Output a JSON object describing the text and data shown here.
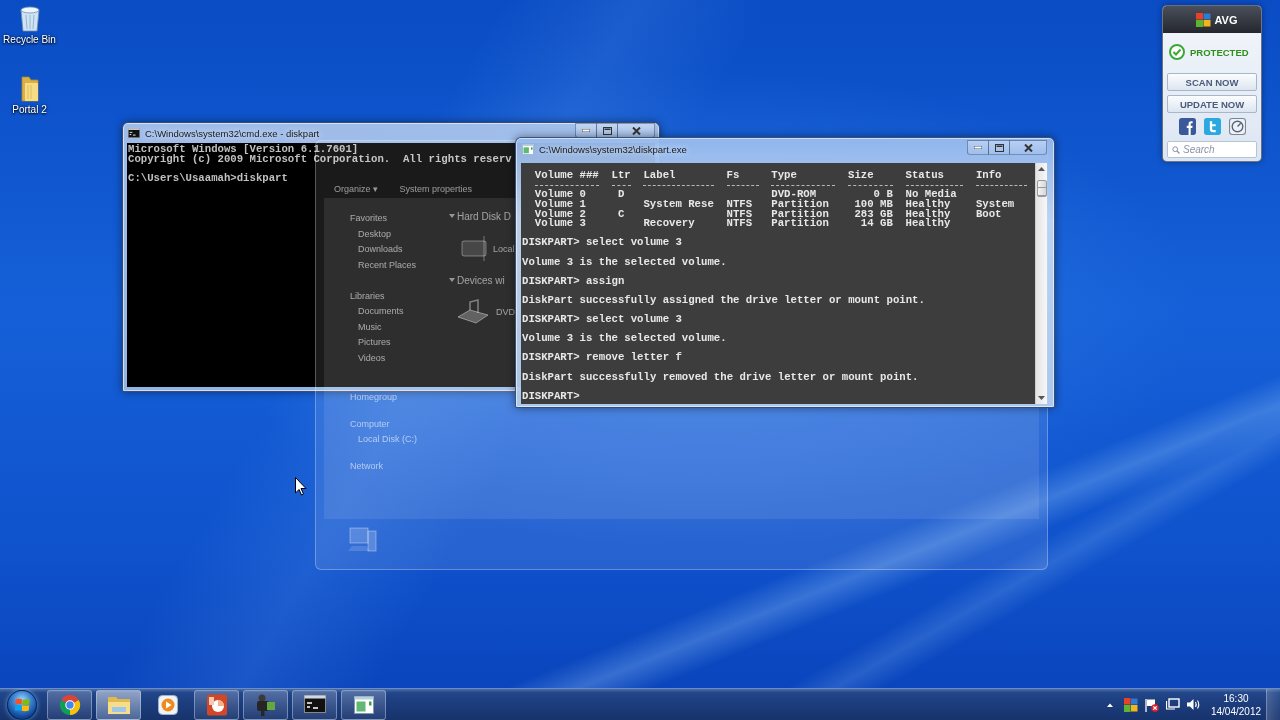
{
  "desktop_icons": [
    {
      "kind": "recycle_bin",
      "label": "Recycle Bin"
    },
    {
      "kind": "folder",
      "label": "Portal 2"
    }
  ],
  "cmd_window": {
    "title": "C:\\Windows\\system32\\cmd.exe - diskpart",
    "blocks": [
      [
        "Microsoft Windows [Version 6.1.7601]",
        "Copyright (c) 2009 Microsoft Corporation.  All rights reserv"
      ],
      [
        "C:\\Users\\Usaamah>diskpart"
      ]
    ]
  },
  "explorer_ghost": {
    "toolbar": [
      "Organize ▾",
      "System properties"
    ],
    "sidebar": [
      {
        "label": "Favorites",
        "children": [
          {
            "label": "Desktop"
          },
          {
            "label": "Downloads"
          },
          {
            "label": "Recent Places"
          }
        ]
      },
      {
        "label": "Libraries",
        "children": [
          {
            "label": "Documents"
          },
          {
            "label": "Music"
          },
          {
            "label": "Pictures"
          },
          {
            "label": "Videos"
          }
        ]
      },
      {
        "label": "Homegroup"
      },
      {
        "label": "Computer",
        "children": [
          {
            "label": "Local Disk (C:)"
          }
        ]
      },
      {
        "label": "Network"
      }
    ],
    "groups": [
      {
        "title": "Hard Disk D",
        "items": [
          {
            "kind": "drive",
            "label": "Local"
          }
        ]
      },
      {
        "title": "Devices wi",
        "items": [
          {
            "kind": "dvd",
            "label": "DVD"
          }
        ]
      }
    ]
  },
  "diskpart_window": {
    "title": "C:\\Windows\\system32\\diskpart.exe",
    "table": {
      "columns": [
        "Volume ###",
        "Ltr",
        "Label",
        "Fs",
        "Type",
        "Size",
        "Status",
        "Info"
      ],
      "rows": [
        [
          "Volume 0",
          "D",
          null,
          null,
          "DVD-ROM",
          "0 B",
          "No Media",
          null
        ],
        [
          "Volume 1",
          null,
          "System Rese",
          "NTFS",
          "Partition",
          "100 MB",
          "Healthy",
          "System"
        ],
        [
          "Volume 2",
          "C",
          null,
          "NTFS",
          "Partition",
          "283 GB",
          "Healthy",
          "Boot"
        ],
        [
          "Volume 3",
          null,
          "Recovery",
          "NTFS",
          "Partition",
          "14 GB",
          "Healthy",
          null
        ]
      ]
    },
    "blocks": [
      [
        "DISKPART> select volume 3"
      ],
      [
        "Volume 3 is the selected volume."
      ],
      [
        "DISKPART> assign"
      ],
      [
        "DiskPart successfully assigned the drive letter or mount point."
      ],
      [
        "DISKPART> select volume 3"
      ],
      [
        "Volume 3 is the selected volume."
      ],
      [
        "DISKPART> remove letter f"
      ],
      [
        "DiskPart successfully removed the drive letter or mount point."
      ],
      [
        "DISKPART>"
      ]
    ]
  },
  "avg_gadget": {
    "brand": "AVG",
    "status": "PROTECTED",
    "buttons": [
      "SCAN NOW",
      "UPDATE NOW"
    ],
    "search": {
      "placeholder": "Search"
    }
  },
  "taskbar": {
    "items": [
      {
        "kind": "browser",
        "running": true,
        "selected": false
      },
      {
        "kind": "folder",
        "running": true,
        "selected": true
      },
      {
        "kind": "media",
        "running": false,
        "selected": false
      },
      {
        "kind": "slides",
        "running": true,
        "selected": false
      },
      {
        "kind": "camera",
        "running": true,
        "selected": false
      },
      {
        "kind": "terminal",
        "running": true,
        "selected": false
      },
      {
        "kind": "window",
        "running": true,
        "selected": false
      }
    ],
    "clock": {
      "time": "16:30",
      "date": "14/04/2012"
    }
  }
}
